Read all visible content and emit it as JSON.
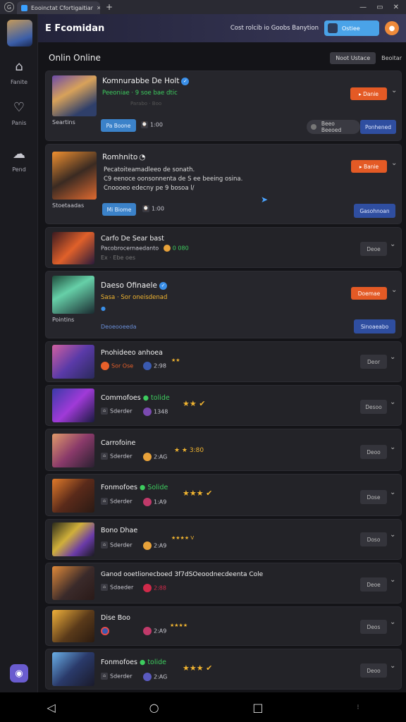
{
  "browser": {
    "tab_title": "Eooinctat Cfortigaitiar",
    "new_tab": "+",
    "minimize": "—",
    "restore": "▭",
    "close": "✕"
  },
  "sidebar": {
    "items": [
      {
        "label": "Fanite",
        "icon": "home-icon"
      },
      {
        "label": "Panis",
        "icon": "heart-icon"
      },
      {
        "label": "Pend",
        "icon": "chat-icon"
      }
    ]
  },
  "topbar": {
    "logo": "E Fcomidan",
    "note": "Cost rolcib io Goobs Banytion",
    "cta": "Ostiee",
    "bell_icon": "bell-icon"
  },
  "main": {
    "heading": "Onlin Online",
    "filter_active": "Noot",
    "filter_active_2": "Ustace",
    "filter_other": "Beoitar"
  },
  "featured": [
    {
      "title": "Komnurabbe De Holt",
      "subtitle": "Peeoniae · 9 soe bae dtic",
      "subtitle_extra": "Parabo · Boo",
      "side_label": "Seartins",
      "action_blue": "Pa Boone",
      "meta": "1:00",
      "orange_label": "▸ Danie",
      "toggle_left": "Beeo Beeoed",
      "toggle_right": "Ponhened"
    },
    {
      "title": "Romhnito",
      "desc": [
        "Pecatoiteamadleeo de sonath.",
        "C9 eenoce oonsonnenta de S ee beeing osina.",
        "Cnoooeo edecny pe 9 bosoa l/"
      ],
      "side_label": "Stoetaadas",
      "action_blue": "Mi Biome",
      "meta": "1:00",
      "orange_label": "▸ Banie",
      "navy_label": "Gasohnoan"
    }
  ],
  "compact_row": {
    "title": "Carfo De Sear bast",
    "subtitle": "Pacobrocernaedanto",
    "value": "0 080",
    "meta": "Ex · Ebe oes",
    "status": "Deoe"
  },
  "featured_3": {
    "title": "Daeso Ofinaele",
    "subtitle": "Sasa · Sor oneisdenad",
    "side_label": "Pointins",
    "link": "Deoeooeeda",
    "orange_label": "Doemae",
    "navy_label": "Sinoaeabo"
  },
  "list": [
    {
      "title": "Pnohideeo anhoea",
      "left": "Sor Ose",
      "right": "2:98",
      "badge": "★★",
      "status": "Deor"
    },
    {
      "title": "Commofoes",
      "leaf": "● tolide",
      "left": "Sderder",
      "right": "1348",
      "badge": "★★ ✔",
      "status": "Desoo"
    },
    {
      "title": "Carrofoine",
      "left": "Sderder",
      "right": "2:AG",
      "badge": "★ ★ 3:80",
      "status": "Deoo"
    },
    {
      "title": "Fonmofoes",
      "leaf": "● Solide",
      "left": "Sderder",
      "right": "1:A9",
      "badge": "★★★ ✔",
      "status": "Dose"
    },
    {
      "title": "Bono Dhae",
      "left": "Sderder",
      "right": "2:A9",
      "badge": "★★★★ V",
      "status": "Doso"
    },
    {
      "title": "Ganod ooetlionecboed 3f7dSOeoodnecdeenta Cole",
      "left": "Sdaeder",
      "right": "2:88",
      "badge": "",
      "status": "Deoe"
    },
    {
      "title": "Dise Boo",
      "left": "",
      "right": "2:A9",
      "badge": "★★★★",
      "status": "Deos"
    },
    {
      "title": "Fonmofoes",
      "leaf": "● tolide",
      "left": "Sderder",
      "right": "2:AG",
      "badge": "★★★ ✔",
      "status": "Deoo"
    }
  ],
  "android_nav": {
    "back": "◁",
    "home": "○",
    "recents": "□"
  }
}
